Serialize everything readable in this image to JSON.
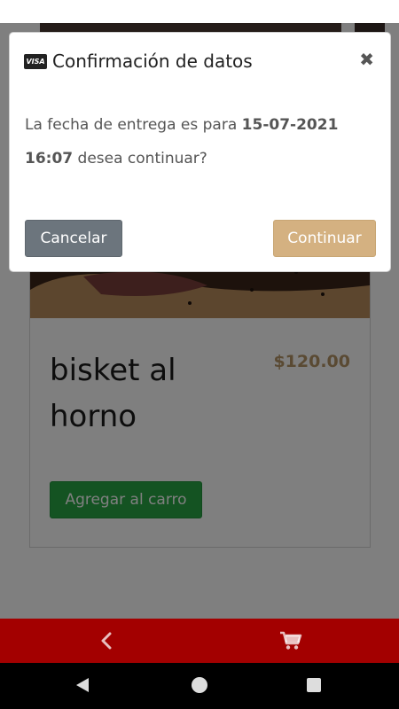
{
  "modal": {
    "title": "Confirmación de datos",
    "card_icon": "visa-card-icon",
    "card_icon_text": "VISA",
    "close_icon": "close-icon",
    "message_prefix": "La fecha de entrega es para ",
    "delivery_date": "15-07-2021",
    "delivery_time": "16:07",
    "message_suffix": " desea continuar?",
    "cancel_label": "Cancelar",
    "continue_label": "Continuar"
  },
  "product": {
    "name": "bisket al horno",
    "price": "$120.00",
    "add_to_cart_label": "Agregar al carro"
  },
  "bottom_nav": {
    "back_icon": "chevron-left-icon",
    "cart_icon": "shopping-cart-icon"
  },
  "colors": {
    "nav_bar": "#a30000",
    "price": "#b59567",
    "continue_button": "#d4b181",
    "cancel_button": "#6c757d",
    "add_to_cart_button": "#28a745"
  }
}
